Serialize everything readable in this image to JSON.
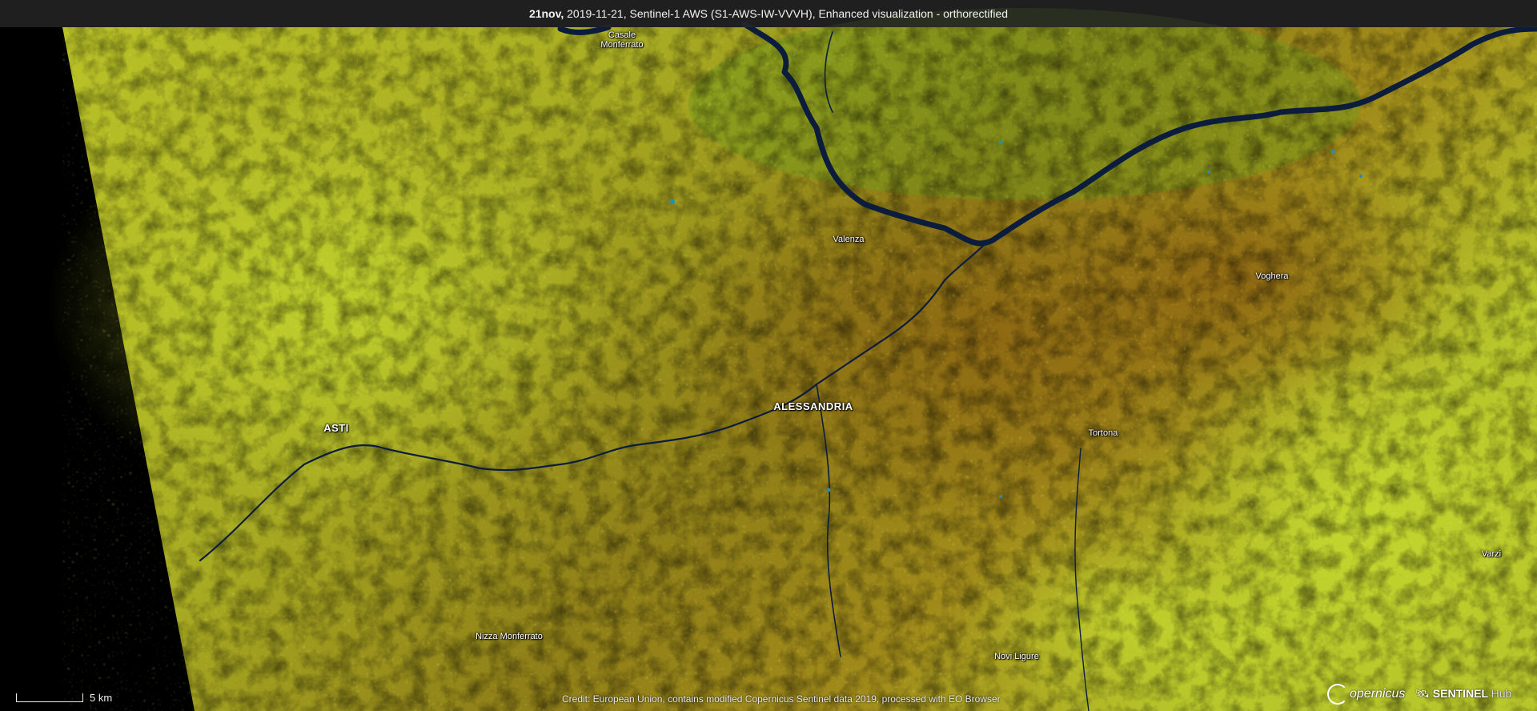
{
  "header": {
    "title_bold": "21nov,",
    "title_rest": " 2019-11-21, Sentinel-1 AWS (S1-AWS-IW-VVVH), Enhanced visualization - orthorectified"
  },
  "places": {
    "casale": "Casale Monferrato",
    "valenza": "Valenza",
    "voghera": "Voghera",
    "alessandria": "ALESSANDRIA",
    "asti": "ASTI",
    "tortona": "Tortona",
    "varzi": "Varzi",
    "nizza": "Nizza Monferrato",
    "novi": "Novi Ligure"
  },
  "scale": {
    "label": "5 km"
  },
  "credit": "Credit: European Union, contains modified Copernicus Sentinel data 2019, processed with EO Browser",
  "logos": {
    "copernicus": "opernicus",
    "sentinel": "SENTINEL",
    "hub": "Hub",
    "copernicus_icon": "copernicus-ring-icon",
    "sentinel_icon": "satellite-icon"
  },
  "colors": {
    "no_data": "#000000",
    "terrain_light": "#d8dc2a",
    "terrain_mid": "#9aa51e",
    "terrain_dark": "#55620f",
    "plain_brown": "#8a6a14",
    "river": "#0a1a3a"
  }
}
